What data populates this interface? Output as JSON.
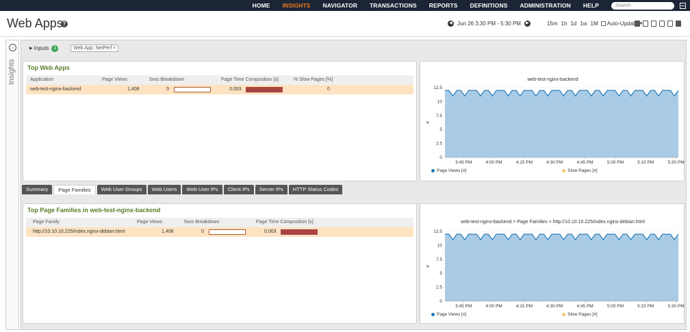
{
  "nav": {
    "items": [
      {
        "label": "HOME",
        "active": false
      },
      {
        "label": "INSIGHTS",
        "active": true
      },
      {
        "label": "NAVIGATOR",
        "active": false
      },
      {
        "label": "TRANSACTIONS",
        "active": false
      },
      {
        "label": "REPORTS",
        "active": false
      },
      {
        "label": "DEFINITIONS",
        "active": false
      },
      {
        "label": "ADMINISTRATION",
        "active": false
      },
      {
        "label": "HELP",
        "active": false
      }
    ],
    "search_placeholder": "Search"
  },
  "header": {
    "title": "Web Apps",
    "time_range": "Jun 26 3:30 PM - 5:30 PM",
    "zoom_options": [
      "15m",
      "1h",
      "1d",
      "1w",
      "1M"
    ],
    "auto_update_label": "Auto-Update"
  },
  "sidebar": {
    "label": "Insights"
  },
  "inputs": {
    "label": "Inputs",
    "count": "1",
    "filter": "Web App: NetPerf",
    "filter_close": "×"
  },
  "top_panel": {
    "title": "Top Web Apps",
    "columns": [
      "Application",
      "Page Views",
      "5xxs Breakdown",
      "Page Time Composition [s]",
      "% Slow Pages [%]"
    ],
    "rows": [
      {
        "application": "web-test-nginx-backend",
        "page_views": "1,408",
        "breakdown_5xx": "0",
        "page_time": "0.003",
        "slow_pages": "0"
      }
    ]
  },
  "tabs": [
    "Summary",
    "Page Families",
    "Web User Groups",
    "Web Users",
    "Web User IPs",
    "Client IPs",
    "Server IPs",
    "HTTP Status Codes"
  ],
  "active_tab": 1,
  "bottom_panel": {
    "title": "Top Page Families in web-test-nginx-backend",
    "columns": [
      "Page Family",
      "Page Views",
      "5xxs Breakdown",
      "Page Time Composition [s]"
    ],
    "rows": [
      {
        "page_family": "http://10.10.10.225/index.nginx-debian.html",
        "page_views": "1,408",
        "breakdown_5xx": "0",
        "page_time": "0.003"
      }
    ]
  },
  "chart_data": [
    {
      "type": "area",
      "title": "web-test-nginx-backend",
      "ylabel": "#",
      "ylim": [
        0,
        12.5
      ],
      "yticks": [
        0,
        2.5,
        5,
        7.5,
        10,
        12.5
      ],
      "xticks": [
        "3:45 PM",
        "4:00 PM",
        "4:15 PM",
        "4:30 PM",
        "4:45 PM",
        "5:00 PM",
        "5:15 PM",
        "5:30 PM"
      ],
      "series": [
        {
          "name": "Page Views [#]",
          "color": "#1f77b4",
          "fill": "#a9cbe5",
          "values": [
            12,
            12,
            11,
            12,
            12,
            11,
            12,
            12,
            12,
            11,
            12,
            12,
            11,
            12,
            12,
            12,
            11,
            12,
            12,
            11,
            12,
            12,
            12,
            11,
            12,
            12,
            11,
            12,
            12,
            12,
            11,
            12,
            12,
            11,
            12,
            12,
            12,
            11,
            12,
            12,
            11,
            12,
            12,
            12,
            11,
            12,
            12,
            11,
            12,
            12,
            12,
            11,
            12,
            12,
            11,
            12,
            12,
            12,
            11,
            12
          ]
        },
        {
          "name": "Slow Pages [#]",
          "color": "#f5c66b",
          "values": []
        }
      ]
    },
    {
      "type": "area",
      "title": "web-test-nginx-backend > Page Families > http://10.10.10.225/index.nginx-debian.html",
      "ylabel": "#",
      "ylim": [
        0,
        12.5
      ],
      "yticks": [
        0,
        2.5,
        5,
        7.5,
        10,
        12.5
      ],
      "xticks": [
        "3:45 PM",
        "4:00 PM",
        "4:15 PM",
        "4:30 PM",
        "4:45 PM",
        "5:00 PM",
        "5:15 PM",
        "5:30 PM"
      ],
      "series": [
        {
          "name": "Page Views [#]",
          "color": "#1f77b4",
          "fill": "#a9cbe5",
          "values": [
            12,
            12,
            11,
            12,
            12,
            11,
            12,
            12,
            12,
            11,
            12,
            12,
            11,
            12,
            12,
            12,
            11,
            12,
            12,
            11,
            12,
            12,
            12,
            11,
            12,
            12,
            11,
            12,
            12,
            12,
            11,
            12,
            12,
            11,
            12,
            12,
            12,
            11,
            12,
            12,
            11,
            12,
            12,
            12,
            11,
            12,
            12,
            11,
            12,
            12,
            12,
            11,
            12,
            12,
            11,
            12,
            12,
            12,
            11,
            12
          ]
        },
        {
          "name": "Slow Pages [#]",
          "color": "#f5c66b",
          "values": []
        }
      ]
    }
  ]
}
